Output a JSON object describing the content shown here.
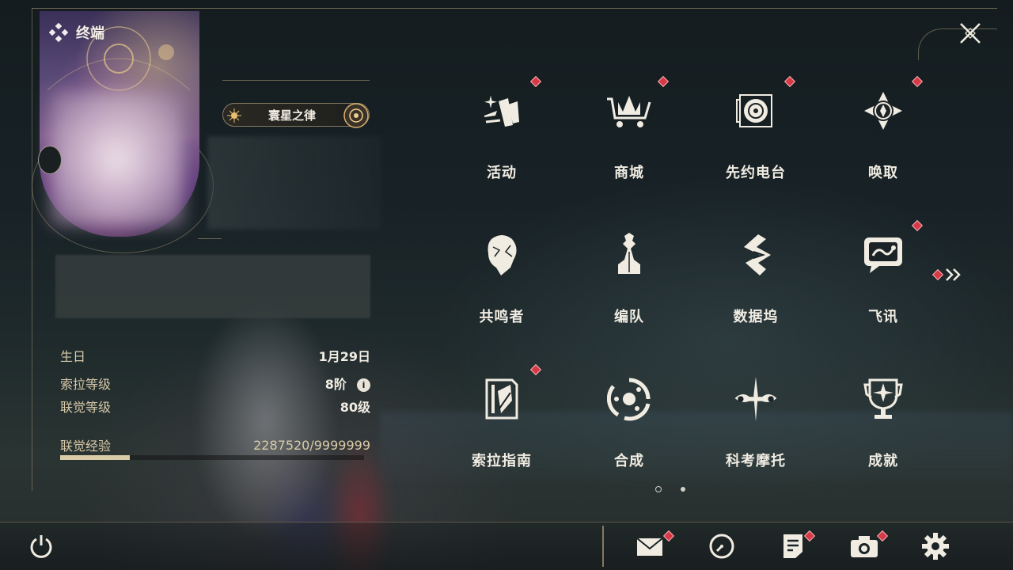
{
  "header": {
    "title": "终端"
  },
  "profile": {
    "title_badge": "寰星之律",
    "stats": {
      "birthday_label": "生日",
      "birthday_value": "1月29日",
      "sola_level_label": "索拉等级",
      "sola_level_value": "8阶",
      "union_level_label": "联觉等级",
      "union_level_value": "80级",
      "union_exp_label": "联觉经验",
      "union_exp_value": "2287520/9999999",
      "union_exp_progress": 0.2288
    }
  },
  "menu": {
    "items": [
      {
        "label": "活动",
        "icon": "activity-icon",
        "notification": true
      },
      {
        "label": "商城",
        "icon": "shop-icon",
        "notification": true
      },
      {
        "label": "先约电台",
        "icon": "radio-icon",
        "notification": true
      },
      {
        "label": "唤取",
        "icon": "convene-icon",
        "notification": true
      },
      {
        "label": "共鸣者",
        "icon": "resonator-icon",
        "notification": false
      },
      {
        "label": "编队",
        "icon": "team-icon",
        "notification": false
      },
      {
        "label": "数据坞",
        "icon": "data-bank-icon",
        "notification": false
      },
      {
        "label": "飞讯",
        "icon": "message-icon",
        "notification": true
      },
      {
        "label": "索拉指南",
        "icon": "guidebook-icon",
        "notification": true
      },
      {
        "label": "合成",
        "icon": "synthesis-icon",
        "notification": false
      },
      {
        "label": "科考摩托",
        "icon": "motorcycle-icon",
        "notification": false
      },
      {
        "label": "成就",
        "icon": "achievement-icon",
        "notification": false
      }
    ],
    "page_indicator": {
      "current": 1,
      "total": 2
    }
  },
  "bottom_bar": {
    "icons": [
      "power-icon",
      "mail-icon",
      "clock-icon",
      "notice-icon",
      "camera-icon",
      "settings-icon"
    ]
  },
  "colors": {
    "accent": "#d9cba6",
    "notification": "#d63a47",
    "text": "#f0ece2"
  }
}
